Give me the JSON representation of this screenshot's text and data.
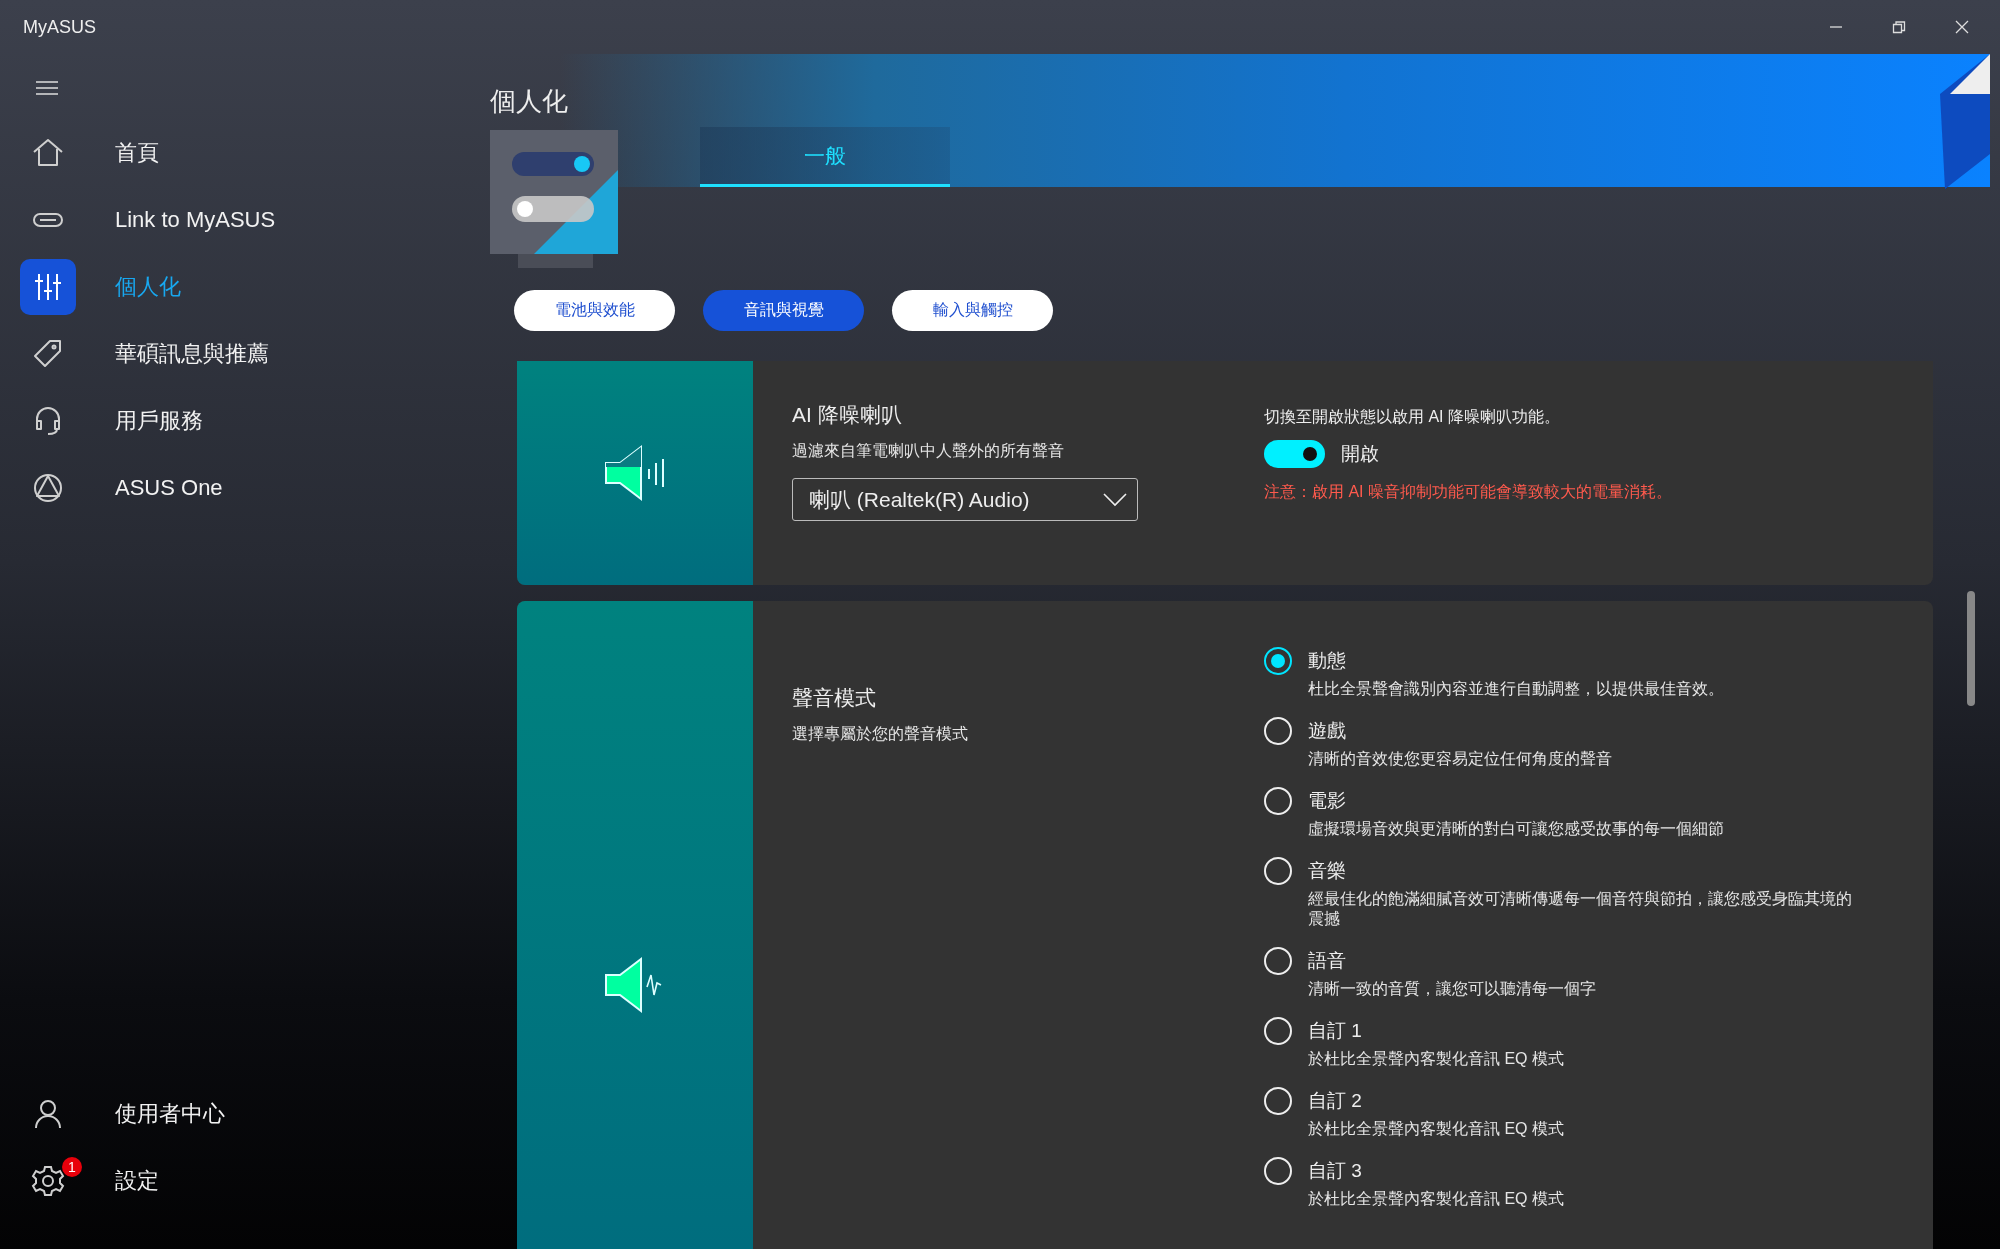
{
  "window": {
    "title": "MyASUS"
  },
  "sidebar": {
    "items": [
      {
        "label": "首頁",
        "selected": false
      },
      {
        "label": "Link to MyASUS",
        "selected": false
      },
      {
        "label": "個人化",
        "selected": true
      },
      {
        "label": "華碩訊息與推薦",
        "selected": false
      },
      {
        "label": "用戶服務",
        "selected": false
      },
      {
        "label": "ASUS One",
        "selected": false
      }
    ],
    "bottom_items": [
      {
        "label": "使用者中心"
      },
      {
        "label": "設定",
        "badge": "1"
      }
    ]
  },
  "page": {
    "title": "個人化"
  },
  "tabs": [
    {
      "label": "一般",
      "selected": true
    }
  ],
  "categories": [
    {
      "label": "電池與效能",
      "selected": false
    },
    {
      "label": "音訊與視覺",
      "selected": true
    },
    {
      "label": "輸入與觸控",
      "selected": false
    }
  ],
  "ai_noise_card": {
    "title": "AI 降噪喇叭",
    "subtitle": "過濾來自筆電喇叭中人聲外的所有聲音",
    "dropdown": {
      "value": "喇叭 (Realtek(R) Audio)"
    },
    "hint": "切換至開啟狀態以啟用 AI 降噪喇叭功能。",
    "toggle": {
      "on": true,
      "label": "開啟"
    },
    "warning": "注意：啟用 AI 噪音抑制功能可能會導致較大的電量消耗。"
  },
  "sound_mode_card": {
    "title": "聲音模式",
    "subtitle": "選擇專屬於您的聲音模式",
    "options": [
      {
        "label": "動態",
        "description": "杜比全景聲會識別內容並進行自動調整，以提供最佳音效。",
        "selected": true
      },
      {
        "label": "遊戲",
        "description": "清晰的音效使您更容易定位任何角度的聲音",
        "selected": false
      },
      {
        "label": "電影",
        "description": "虛擬環場音效與更清晰的對白可讓您感受故事的每一個細節",
        "selected": false
      },
      {
        "label": "音樂",
        "description": "經最佳化的飽滿細膩音效可清晰傳遞每一個音符與節拍，讓您感受身臨其境的震撼",
        "selected": false
      },
      {
        "label": "語音",
        "description": "清晰一致的音質，讓您可以聽清每一個字",
        "selected": false
      },
      {
        "label": "自訂 1",
        "description": "於杜比全景聲內客製化音訊 EQ 模式",
        "selected": false
      },
      {
        "label": "自訂 2",
        "description": "於杜比全景聲內客製化音訊 EQ 模式",
        "selected": false
      },
      {
        "label": "自訂 3",
        "description": "於杜比全景聲內客製化音訊 EQ 模式",
        "selected": false
      }
    ]
  }
}
